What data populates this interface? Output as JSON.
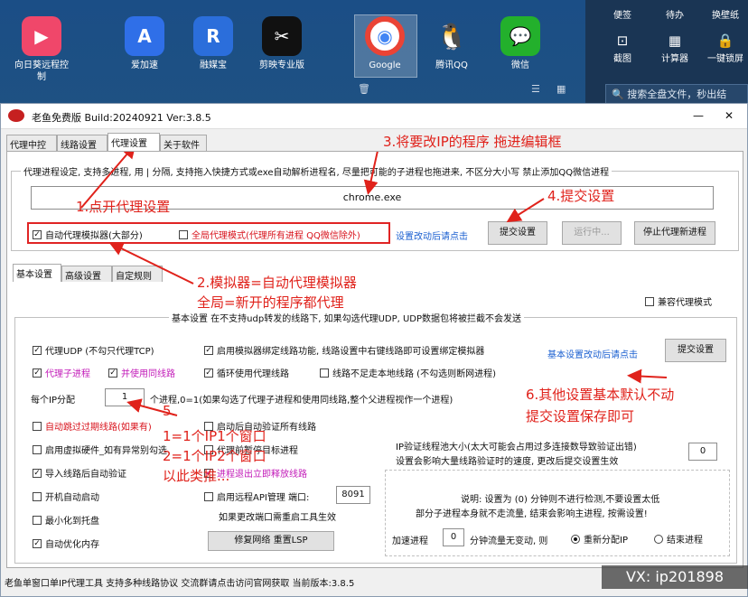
{
  "desktop": {
    "icons": [
      {
        "label": "向日葵远程控制",
        "glyph": "▶",
        "color": "#f0476a"
      },
      {
        "label": "爱加速",
        "glyph": "A",
        "color": "#2f6fe8"
      },
      {
        "label": "融媒宝",
        "glyph": "R",
        "color": "#2b6edb"
      },
      {
        "label": "剪映专业版",
        "glyph": "✂",
        "color": "#111111"
      },
      {
        "label": "Google",
        "glyph": "◉",
        "color": "#4285f4"
      },
      {
        "label": "腾讯QQ",
        "glyph": "🐧",
        "color": "#1d1d1d"
      },
      {
        "label": "微信",
        "glyph": "💬",
        "color": "#23b02c"
      }
    ],
    "right_panel": [
      {
        "label": "便签",
        "glyph": ""
      },
      {
        "label": "待办",
        "glyph": ""
      },
      {
        "label": "换壁纸",
        "glyph": ""
      },
      {
        "label": "截图",
        "glyph": "⊡"
      },
      {
        "label": "计算器",
        "glyph": "▦"
      },
      {
        "label": "一键锁屏",
        "glyph": "🔒"
      }
    ],
    "search_placeholder": "搜索全盘文件，秒出结"
  },
  "window": {
    "title": "老鱼免费版 Build:20240921 Ver:3.8.5",
    "controls": {
      "minimize": "—",
      "close": "✕"
    },
    "tabs": [
      "代理中控",
      "线路设置",
      "代理设置",
      "关于软件"
    ],
    "process_group": {
      "legend": "代理进程设定, 支持多进程, 用 | 分隔, 支持拖入快捷方式或exe自动解析进程名, 尽量把可能的子进程也拖进来, 不区分大小写 禁止添加QQ微信进程",
      "input_value": "chrome.exe",
      "auto_proxy_label": "自动代理模拟器(大部分)",
      "global_proxy_label": "全局代理模式(代理所有进程 QQ微信除外)",
      "hint": "设置改动后请点击",
      "submit": "提交设置",
      "running": "运行中...",
      "stop": "停止代理新进程"
    },
    "sub_tabs": [
      "基本设置",
      "高级设置",
      "自定规则"
    ],
    "compat_label": "兼容代理模式",
    "basic": {
      "legend": "基本设置  在不支持udp转发的线路下, 如果勾选代理UDP, UDP数据包将被拦截不会发送",
      "proxy_udp": "代理UDP (不勾只代理TCP)",
      "emu_bind": "启用模拟器绑定线路功能, 线路设置中右键线路即可设置绑定模拟器",
      "sub_process": "代理子进程",
      "same_line": "并使用同线路",
      "loop_line": "循环使用代理线路",
      "insufficient": "线路不足走本地线路 (不勾选则断网进程)",
      "per_ip_prefix": "每个IP分配",
      "per_ip_value": "1",
      "per_ip_suffix": "个进程,0=1(如果勾选了代理子进程和使用同线路,整个父进程视作一个进程)",
      "skip_expired": "自动跳过过期线路(如果有)",
      "auto_verify": "启动后自动验证所有线路",
      "virtual_hw": "启用虚拟硬件_如有异常别勾选",
      "close_target": "代理前暂停目标进程",
      "auto_verify_import": "导入线路后自动验证",
      "release_line": "进程退出立即释放线路",
      "autostart": "开机自动启动",
      "remote_api": "启用远程API管理  端口:",
      "port": "8091",
      "port_hint": "如果更改端口需重启工具生效",
      "minimize": "最小化到托盘",
      "auto_mem": "自动优化内存",
      "repair": "修复网络 重置LSP",
      "hint2": "基本设置改动后请点击",
      "submit2": "提交设置",
      "pool_line1": "IP验证线程池大小(太大可能会占用过多连接数导致验证出错)",
      "pool_line2": "设置会影响大量线路验证时的速度, 更改后提交设置生效",
      "pool_value": "0",
      "note_line1": "说明: 设置为 (0) 分钟则不进行检测,不要设置太低",
      "note_line2": "部分子进程本身就不走流量, 结束会影响主进程, 按需设置!",
      "accel_label": "加速进程",
      "accel_value": "0",
      "accel_suffix": "分钟流量无变动, 则",
      "realloc": "重新分配IP",
      "end_process": "结束进程"
    },
    "status": "老鱼单窗口单IP代理工具 支持多种线路协议 交流群请点击访问官网获取   当前版本:3.8.5"
  },
  "annotations": {
    "a1": "1.点开代理设置",
    "a2": "2.模拟器=自动代理模拟器",
    "a2b": "全局=新开的程序都代理",
    "a3": "3.将要改IP的程序 拖进编辑框",
    "a4": "4.提交设置",
    "a5a": "1=1个IP1个窗口",
    "a5b": "2=1个IP2个窗口",
    "a5c": "以此类推...",
    "a5num": "5.",
    "a6a": "6.其他设置基本默认不动",
    "a6b": "提交设置保存即可"
  },
  "watermark": "VX: ip201898",
  "colors": {
    "accent": "#1a5fd0",
    "annotation": "#e0221b",
    "magenta": "#c21ab8"
  }
}
